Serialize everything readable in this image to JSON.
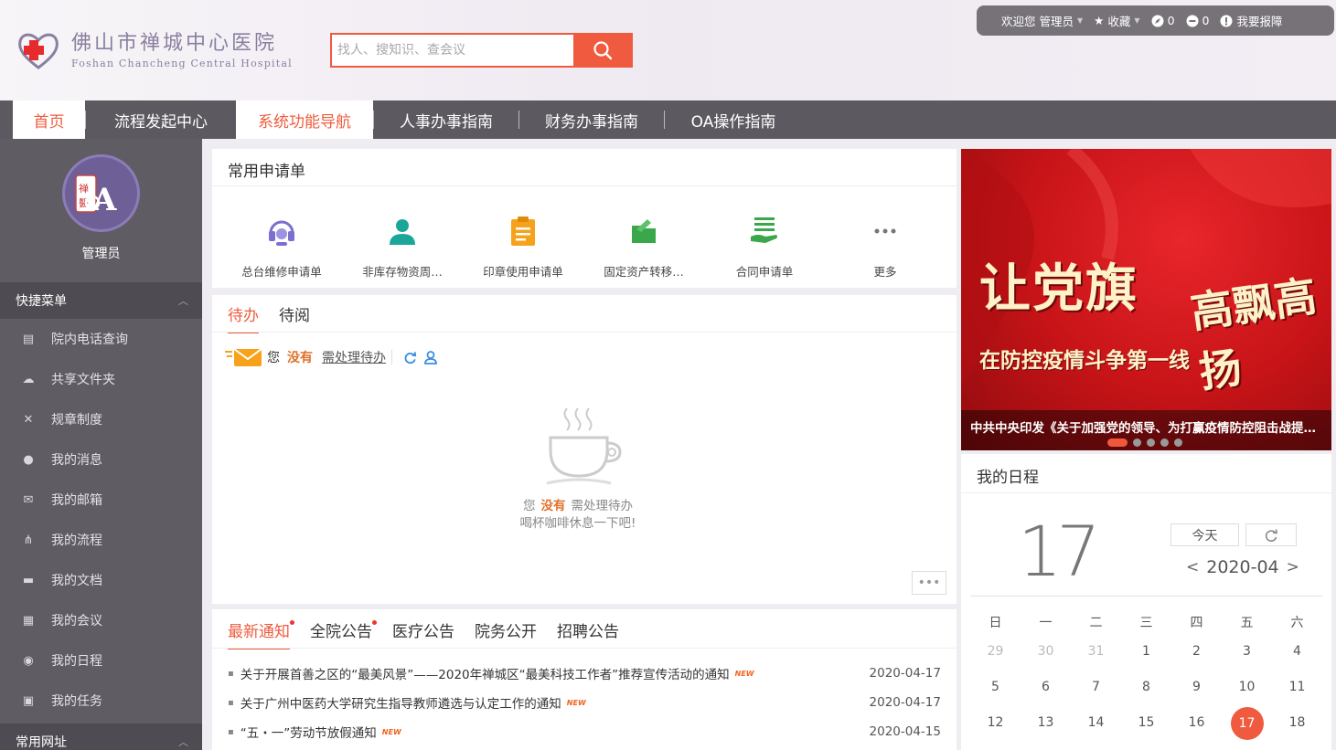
{
  "hospital": {
    "name_cn": "佛山市禅城中心医院",
    "name_en": "Foshan Chancheng Central Hospital"
  },
  "search": {
    "placeholder": "找人、搜知识、查会议"
  },
  "topbar": {
    "welcome": "欢迎您",
    "user": "管理员",
    "favorites": "收藏",
    "count_a": "0",
    "count_b": "0",
    "report": "我要报障"
  },
  "nav": [
    {
      "label": "首页",
      "active": false
    },
    {
      "label": "流程发起中心",
      "active": false
    },
    {
      "label": "系统功能导航",
      "active": true
    },
    {
      "label": "人事办事指南",
      "active": false
    },
    {
      "label": "财务办事指南",
      "active": false
    },
    {
      "label": "OA操作指南",
      "active": false
    }
  ],
  "sidebar": {
    "username": "管理员",
    "quick_menu": "快捷菜单",
    "items": [
      {
        "label": "院内电话查询",
        "icon": "contact-card-icon"
      },
      {
        "label": "共享文件夹",
        "icon": "cloud-icon"
      },
      {
        "label": "规章制度",
        "icon": "tools-icon"
      },
      {
        "label": "我的消息",
        "icon": "chat-bubble-icon"
      },
      {
        "label": "我的邮箱",
        "icon": "mail-icon"
      },
      {
        "label": "我的流程",
        "icon": "flow-icon"
      },
      {
        "label": "我的文档",
        "icon": "folder-icon"
      },
      {
        "label": "我的会议",
        "icon": "meeting-icon"
      },
      {
        "label": "我的日程",
        "icon": "schedule-icon"
      },
      {
        "label": "我的任务",
        "icon": "task-icon"
      }
    ],
    "links_section": "常用网址"
  },
  "apps": {
    "title": "常用申请单",
    "items": [
      {
        "label": "总台维修申请单",
        "icon": "headset-icon",
        "color": "#7b6fd0"
      },
      {
        "label": "非库存物资周…",
        "icon": "user-icon",
        "color": "#1aa79a"
      },
      {
        "label": "印章使用申请单",
        "icon": "clipboard-icon",
        "color": "#f7a21b"
      },
      {
        "label": "固定资产转移…",
        "icon": "folder-open-icon",
        "color": "#3aa84a"
      },
      {
        "label": "合同申请单",
        "icon": "contract-hand-icon",
        "color": "#3aa84a"
      },
      {
        "label": "更多",
        "icon": "more-icon",
        "color": "#777777"
      }
    ]
  },
  "todo": {
    "tabs": [
      "待办",
      "待阅"
    ],
    "you": "您",
    "none": "没有",
    "pending": "需处理待办",
    "empty_line2": "喝杯咖啡休息一下吧!",
    "more": "•••"
  },
  "news": {
    "tabs": [
      "最新通知",
      "全院公告",
      "医疗公告",
      "院务公开",
      "招聘公告"
    ],
    "new_badge": "NEW",
    "items": [
      {
        "title": "关于开展首善之区的“最美风景”——2020年禅城区“最美科技工作者”推荐宣传活动的通知",
        "date": "2020-04-17"
      },
      {
        "title": "关于广州中医药大学研究生指导教师遴选与认定工作的通知",
        "date": "2020-04-17"
      },
      {
        "title": "“五・一”劳动节放假通知",
        "date": "2020-04-15"
      }
    ]
  },
  "banner": {
    "headline": "让党旗",
    "headline_side": "高飘高扬",
    "subline": "在防控疫情斗争第一线",
    "caption": "中共中央印发《关于加强党的领导、为打赢疫情防控阻击战提供坚强政治保证的通知》"
  },
  "calendar": {
    "title": "我的日程",
    "day": "17",
    "today": "今天",
    "month": "2020-04",
    "prev": "<",
    "next": ">",
    "weekdays": [
      "日",
      "一",
      "二",
      "三",
      "四",
      "五",
      "六"
    ],
    "weeks": [
      [
        "29",
        "30",
        "31",
        "1",
        "2",
        "3",
        "4"
      ],
      [
        "5",
        "6",
        "7",
        "8",
        "9",
        "10",
        "11"
      ],
      [
        "12",
        "13",
        "14",
        "15",
        "16",
        "17",
        "18"
      ]
    ],
    "selected": "17"
  }
}
